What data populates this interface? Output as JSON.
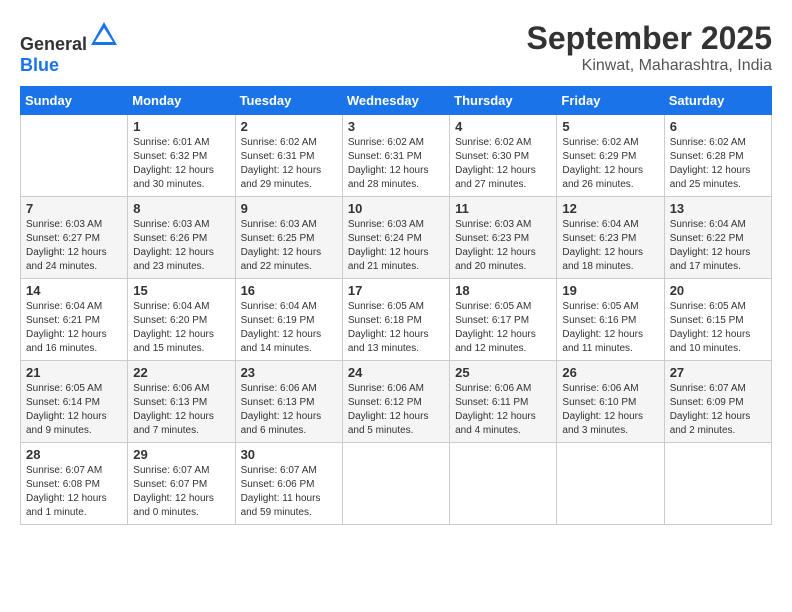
{
  "header": {
    "logo_general": "General",
    "logo_blue": "Blue",
    "month": "September 2025",
    "location": "Kinwat, Maharashtra, India"
  },
  "days_of_week": [
    "Sunday",
    "Monday",
    "Tuesday",
    "Wednesday",
    "Thursday",
    "Friday",
    "Saturday"
  ],
  "weeks": [
    [
      {
        "day": "",
        "sunrise": "",
        "sunset": "",
        "daylight": ""
      },
      {
        "day": "1",
        "sunrise": "Sunrise: 6:01 AM",
        "sunset": "Sunset: 6:32 PM",
        "daylight": "Daylight: 12 hours and 30 minutes."
      },
      {
        "day": "2",
        "sunrise": "Sunrise: 6:02 AM",
        "sunset": "Sunset: 6:31 PM",
        "daylight": "Daylight: 12 hours and 29 minutes."
      },
      {
        "day": "3",
        "sunrise": "Sunrise: 6:02 AM",
        "sunset": "Sunset: 6:31 PM",
        "daylight": "Daylight: 12 hours and 28 minutes."
      },
      {
        "day": "4",
        "sunrise": "Sunrise: 6:02 AM",
        "sunset": "Sunset: 6:30 PM",
        "daylight": "Daylight: 12 hours and 27 minutes."
      },
      {
        "day": "5",
        "sunrise": "Sunrise: 6:02 AM",
        "sunset": "Sunset: 6:29 PM",
        "daylight": "Daylight: 12 hours and 26 minutes."
      },
      {
        "day": "6",
        "sunrise": "Sunrise: 6:02 AM",
        "sunset": "Sunset: 6:28 PM",
        "daylight": "Daylight: 12 hours and 25 minutes."
      }
    ],
    [
      {
        "day": "7",
        "sunrise": "Sunrise: 6:03 AM",
        "sunset": "Sunset: 6:27 PM",
        "daylight": "Daylight: 12 hours and 24 minutes."
      },
      {
        "day": "8",
        "sunrise": "Sunrise: 6:03 AM",
        "sunset": "Sunset: 6:26 PM",
        "daylight": "Daylight: 12 hours and 23 minutes."
      },
      {
        "day": "9",
        "sunrise": "Sunrise: 6:03 AM",
        "sunset": "Sunset: 6:25 PM",
        "daylight": "Daylight: 12 hours and 22 minutes."
      },
      {
        "day": "10",
        "sunrise": "Sunrise: 6:03 AM",
        "sunset": "Sunset: 6:24 PM",
        "daylight": "Daylight: 12 hours and 21 minutes."
      },
      {
        "day": "11",
        "sunrise": "Sunrise: 6:03 AM",
        "sunset": "Sunset: 6:23 PM",
        "daylight": "Daylight: 12 hours and 20 minutes."
      },
      {
        "day": "12",
        "sunrise": "Sunrise: 6:04 AM",
        "sunset": "Sunset: 6:23 PM",
        "daylight": "Daylight: 12 hours and 18 minutes."
      },
      {
        "day": "13",
        "sunrise": "Sunrise: 6:04 AM",
        "sunset": "Sunset: 6:22 PM",
        "daylight": "Daylight: 12 hours and 17 minutes."
      }
    ],
    [
      {
        "day": "14",
        "sunrise": "Sunrise: 6:04 AM",
        "sunset": "Sunset: 6:21 PM",
        "daylight": "Daylight: 12 hours and 16 minutes."
      },
      {
        "day": "15",
        "sunrise": "Sunrise: 6:04 AM",
        "sunset": "Sunset: 6:20 PM",
        "daylight": "Daylight: 12 hours and 15 minutes."
      },
      {
        "day": "16",
        "sunrise": "Sunrise: 6:04 AM",
        "sunset": "Sunset: 6:19 PM",
        "daylight": "Daylight: 12 hours and 14 minutes."
      },
      {
        "day": "17",
        "sunrise": "Sunrise: 6:05 AM",
        "sunset": "Sunset: 6:18 PM",
        "daylight": "Daylight: 12 hours and 13 minutes."
      },
      {
        "day": "18",
        "sunrise": "Sunrise: 6:05 AM",
        "sunset": "Sunset: 6:17 PM",
        "daylight": "Daylight: 12 hours and 12 minutes."
      },
      {
        "day": "19",
        "sunrise": "Sunrise: 6:05 AM",
        "sunset": "Sunset: 6:16 PM",
        "daylight": "Daylight: 12 hours and 11 minutes."
      },
      {
        "day": "20",
        "sunrise": "Sunrise: 6:05 AM",
        "sunset": "Sunset: 6:15 PM",
        "daylight": "Daylight: 12 hours and 10 minutes."
      }
    ],
    [
      {
        "day": "21",
        "sunrise": "Sunrise: 6:05 AM",
        "sunset": "Sunset: 6:14 PM",
        "daylight": "Daylight: 12 hours and 9 minutes."
      },
      {
        "day": "22",
        "sunrise": "Sunrise: 6:06 AM",
        "sunset": "Sunset: 6:13 PM",
        "daylight": "Daylight: 12 hours and 7 minutes."
      },
      {
        "day": "23",
        "sunrise": "Sunrise: 6:06 AM",
        "sunset": "Sunset: 6:13 PM",
        "daylight": "Daylight: 12 hours and 6 minutes."
      },
      {
        "day": "24",
        "sunrise": "Sunrise: 6:06 AM",
        "sunset": "Sunset: 6:12 PM",
        "daylight": "Daylight: 12 hours and 5 minutes."
      },
      {
        "day": "25",
        "sunrise": "Sunrise: 6:06 AM",
        "sunset": "Sunset: 6:11 PM",
        "daylight": "Daylight: 12 hours and 4 minutes."
      },
      {
        "day": "26",
        "sunrise": "Sunrise: 6:06 AM",
        "sunset": "Sunset: 6:10 PM",
        "daylight": "Daylight: 12 hours and 3 minutes."
      },
      {
        "day": "27",
        "sunrise": "Sunrise: 6:07 AM",
        "sunset": "Sunset: 6:09 PM",
        "daylight": "Daylight: 12 hours and 2 minutes."
      }
    ],
    [
      {
        "day": "28",
        "sunrise": "Sunrise: 6:07 AM",
        "sunset": "Sunset: 6:08 PM",
        "daylight": "Daylight: 12 hours and 1 minute."
      },
      {
        "day": "29",
        "sunrise": "Sunrise: 6:07 AM",
        "sunset": "Sunset: 6:07 PM",
        "daylight": "Daylight: 12 hours and 0 minutes."
      },
      {
        "day": "30",
        "sunrise": "Sunrise: 6:07 AM",
        "sunset": "Sunset: 6:06 PM",
        "daylight": "Daylight: 11 hours and 59 minutes."
      },
      {
        "day": "",
        "sunrise": "",
        "sunset": "",
        "daylight": ""
      },
      {
        "day": "",
        "sunrise": "",
        "sunset": "",
        "daylight": ""
      },
      {
        "day": "",
        "sunrise": "",
        "sunset": "",
        "daylight": ""
      },
      {
        "day": "",
        "sunrise": "",
        "sunset": "",
        "daylight": ""
      }
    ]
  ]
}
